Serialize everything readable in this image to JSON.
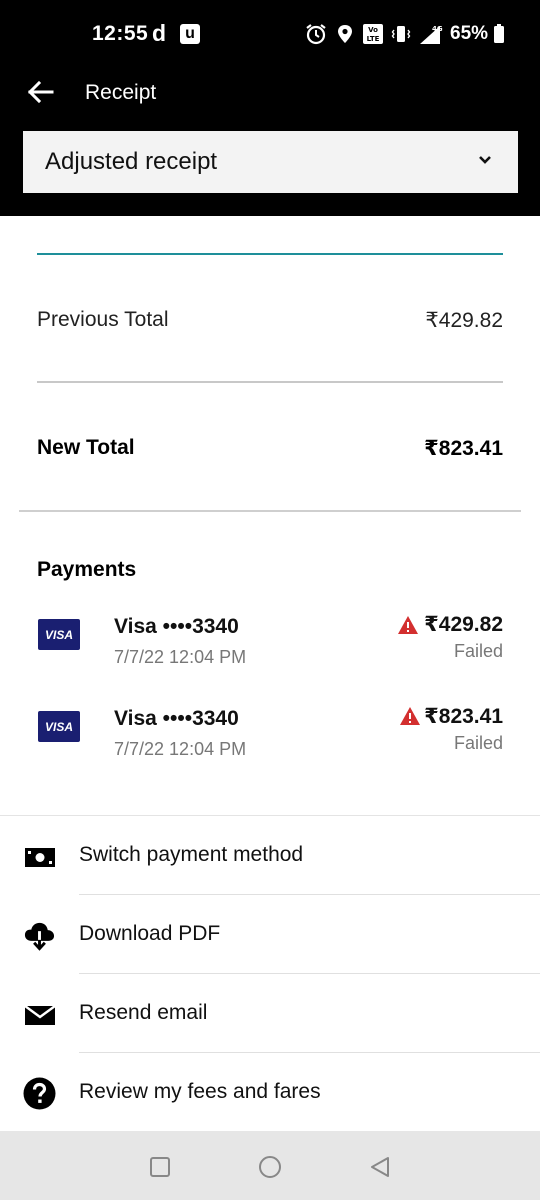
{
  "status_bar": {
    "time": "12:55",
    "app_icon_1": "d",
    "app_icon_2": "u",
    "battery": "65%",
    "icons": [
      "alarm-icon",
      "location-icon",
      "volte-icon",
      "vibrate-icon",
      "signal-4g-icon",
      "battery-icon"
    ]
  },
  "header": {
    "title": "Receipt",
    "back_icon": "arrow-left-icon"
  },
  "receipt_select": {
    "value": "Adjusted receipt",
    "icon": "chevron-down-icon"
  },
  "totals": {
    "previous_label": "Previous Total",
    "previous_value": "₹429.82",
    "new_label": "New Total",
    "new_value": "₹823.41"
  },
  "payments": {
    "heading": "Payments",
    "items": [
      {
        "card_brand": "VISA",
        "card_name": "Visa ••••3340",
        "date": "7/7/22 12:04 PM",
        "amount": "₹429.82",
        "status": "Failed"
      },
      {
        "card_brand": "VISA",
        "card_name": "Visa ••••3340",
        "date": "7/7/22 12:04 PM",
        "amount": "₹823.41",
        "status": "Failed"
      }
    ],
    "status_color": "#d32f2f"
  },
  "actions": [
    {
      "label": "Switch payment method",
      "icon": "cash-icon"
    },
    {
      "label": "Download PDF",
      "icon": "cloud-download-icon"
    },
    {
      "label": "Resend email",
      "icon": "envelope-icon"
    },
    {
      "label": "Review my fees and fares",
      "icon": "help-circle-icon"
    }
  ],
  "nav_bar": {
    "icons": [
      "recent-apps-icon",
      "home-icon",
      "back-triangle-icon"
    ]
  },
  "colors": {
    "header_bg": "#000000",
    "accent_line": "#1e8f9a",
    "visa_blue": "#1a1f71",
    "warning_red": "#d32f2f"
  }
}
